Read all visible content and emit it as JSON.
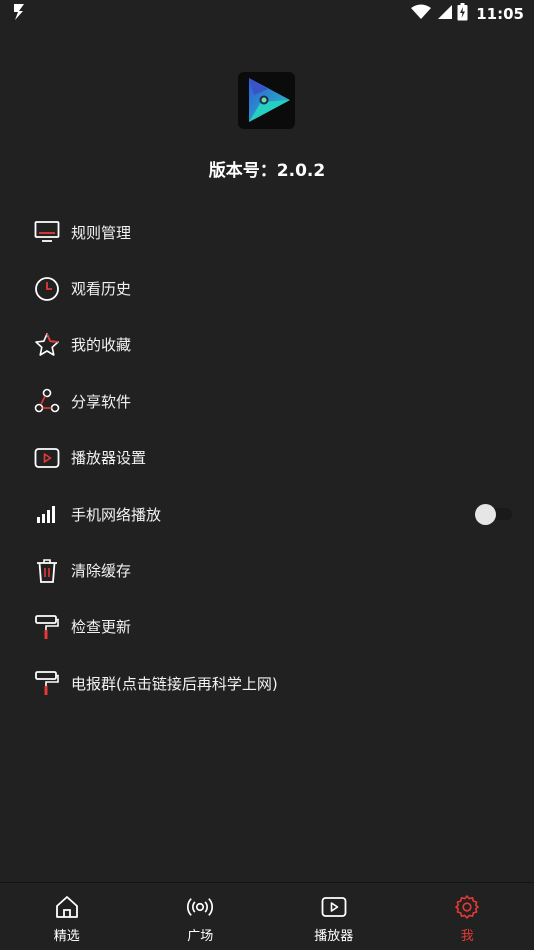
{
  "status_bar": {
    "time": "11:05"
  },
  "app": {
    "version_label": "版本号：2.0.2"
  },
  "menu": {
    "items": [
      {
        "label": "规则管理",
        "icon": "monitor-icon"
      },
      {
        "label": "观看历史",
        "icon": "clock-icon"
      },
      {
        "label": "我的收藏",
        "icon": "star-icon"
      },
      {
        "label": "分享软件",
        "icon": "share-icon"
      },
      {
        "label": "播放器设置",
        "icon": "play-box-icon"
      },
      {
        "label": "手机网络播放",
        "icon": "signal-icon",
        "toggle": false
      },
      {
        "label": "清除缓存",
        "icon": "trash-icon"
      },
      {
        "label": "检查更新",
        "icon": "paint-roller-icon"
      },
      {
        "label": "电报群(点击链接后再科学上网)",
        "icon": "paint-roller-icon"
      }
    ]
  },
  "bottom_nav": {
    "items": [
      {
        "label": "精选",
        "icon": "home-icon"
      },
      {
        "label": "广场",
        "icon": "broadcast-icon"
      },
      {
        "label": "播放器",
        "icon": "play-box-icon"
      },
      {
        "label": "我",
        "icon": "gear-icon",
        "active": true
      }
    ]
  },
  "colors": {
    "background": "#212121",
    "accent": "#e53935",
    "text": "#ffffff"
  }
}
